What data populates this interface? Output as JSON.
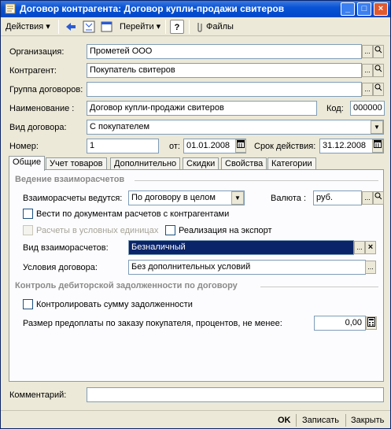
{
  "window": {
    "title": "Договор контрагента: Договор купли-продажи свитеров",
    "controls": {
      "minimize": "_",
      "maximize": "□",
      "close": "×"
    }
  },
  "toolbar": {
    "actions_label": "Действия",
    "goto_label": "Перейти",
    "help_label": "?",
    "files_label": "Файлы"
  },
  "form": {
    "organization": {
      "label": "Организация:",
      "value": "Прометей ООО"
    },
    "counterparty": {
      "label": "Контрагент:",
      "value": "Покупатель свитеров"
    },
    "group": {
      "label": "Группа договоров:",
      "value": ""
    },
    "name": {
      "label": "Наименование :",
      "value": "Договор купли-продажи свитеров"
    },
    "code": {
      "label": "Код:",
      "value": "000000"
    },
    "contract_type": {
      "label": "Вид договора:",
      "value": "С покупателем"
    },
    "number": {
      "label": "Номер:",
      "value": "1"
    },
    "date_from": {
      "label": "от:",
      "value": "01.01.2008"
    },
    "valid_until": {
      "label": "Срок действия:",
      "value": "31.12.2008"
    }
  },
  "tabs": [
    {
      "label": "Общие"
    },
    {
      "label": "Учет товаров"
    },
    {
      "label": "Дополнительно"
    },
    {
      "label": "Скидки"
    },
    {
      "label": "Свойства"
    },
    {
      "label": "Категории"
    }
  ],
  "general": {
    "settlements_section": "Ведение взаиморасчетов",
    "settlements_by_label": "Взаиморасчеты ведутся:",
    "settlements_by_value": "По договору в целом",
    "currency_label": "Валюта :",
    "currency_value": "руб.",
    "by_docs_label": "Вести по документам расчетов с контрагентами",
    "conventional_units_label": "Расчеты в условных единицах",
    "export_label": "Реализация на экспорт",
    "settlement_kind_label": "Вид взаиморасчетов:",
    "settlement_kind_value": "Безналичный",
    "terms_label": "Условия договора:",
    "terms_value": "Без дополнительных условий",
    "debt_section": "Контроль дебиторской задолженности по договору",
    "control_debt_label": "Контролировать сумму задолженности",
    "prepayment_label": "Размер предоплаты по заказу покупателя, процентов, не менее:",
    "prepayment_value": "0,00"
  },
  "comment": {
    "label": "Комментарий:",
    "value": ""
  },
  "footer": {
    "ok": "OK",
    "save": "Записать",
    "close": "Закрыть"
  },
  "colors": {
    "title_bar": "#0a53d6",
    "selection": "#0a246a",
    "window_bg": "#ece9d8"
  }
}
